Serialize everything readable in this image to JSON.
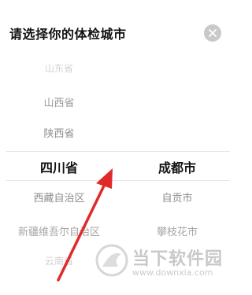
{
  "header": {
    "title": "请选择你的体检城市",
    "close_icon": "close-icon"
  },
  "province_picker": {
    "items": [
      "山东省",
      "山西省",
      "陕西省",
      "四川省",
      "西藏自治区",
      "新疆维吾尔自治区",
      "云南省"
    ],
    "selected": "四川省"
  },
  "city_picker": {
    "items": [
      "成都市",
      "自贡市",
      "攀枝花市"
    ],
    "selected": "成都市"
  },
  "watermark": {
    "text": "当下软件园",
    "url": "www.downxia.com"
  },
  "colors": {
    "annotation_arrow": "#e02a2a",
    "selected_text": "#111111",
    "close_button_bg": "#c9c9c9"
  }
}
